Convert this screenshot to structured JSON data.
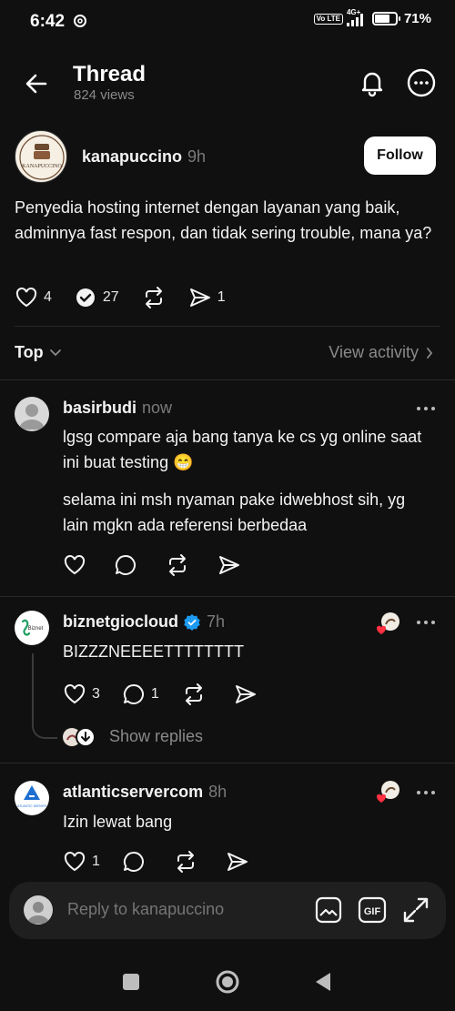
{
  "status": {
    "time": "6:42",
    "volte": "Vo LTE",
    "net": "4G+",
    "battery": "71%",
    "battery_level": 0.71
  },
  "header": {
    "title": "Thread",
    "views": "824 views",
    "back_icon": "back-arrow-icon",
    "bell_icon": "bell-icon",
    "more_icon": "more-icon"
  },
  "post": {
    "username": "kanapuccino",
    "time": "9h",
    "avatar_text": "KANAPUCCINO",
    "follow_label": "Follow",
    "text": "Penyedia hosting internet dengan layanan yang baik, adminnya fast respon, dan tidak sering trouble, mana ya?",
    "likes": "4",
    "replies": "27",
    "shares": "1"
  },
  "sort": {
    "label": "Top",
    "view_activity": "View activity"
  },
  "replies": [
    {
      "username": "basirbudi",
      "time": "now",
      "paragraphs": [
        "lgsg compare aja bang tanya ke cs yg online saat ini buat testing 😁",
        "selama ini msh nyaman pake idwebhost sih, yg lain mgkn ada referensi berbedaa"
      ]
    },
    {
      "username": "biznetgiocloud",
      "time": "7h",
      "avatar_text": "Biznet",
      "text": "BIZZZNEEEETTTTTTTT",
      "likes": "3",
      "replies": "1",
      "show_replies": "Show replies"
    },
    {
      "username": "atlanticservercom",
      "time": "8h",
      "avatar_text": "ATLANTIC SERVER",
      "text": "Izin lewat bang",
      "likes": "1"
    }
  ],
  "reply_bar": {
    "placeholder": "Reply to kanapuccino",
    "gif_label": "GIF"
  },
  "colors": {
    "background": "#101010",
    "text": "#f3f3f3",
    "muted": "#8a8a8a",
    "verified": "#1d9bf0",
    "heart_red": "#ff3040"
  }
}
